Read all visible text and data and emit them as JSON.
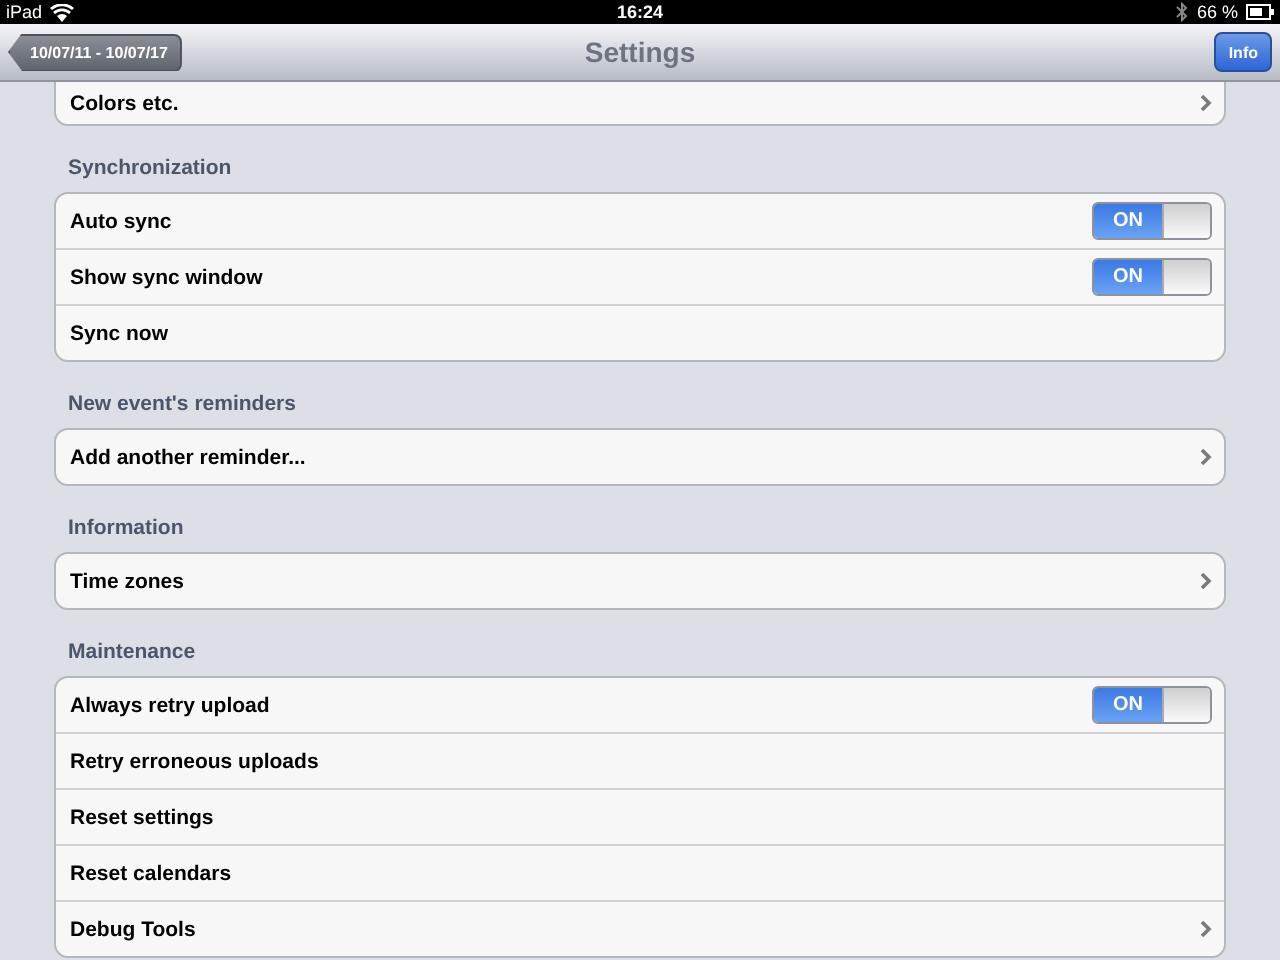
{
  "status_bar": {
    "device": "iPad",
    "time": "16:24",
    "battery": "66 %"
  },
  "nav_bar": {
    "back_button": "10/07/11 - 10/07/17",
    "title": "Settings",
    "info_button": "Info"
  },
  "sections": [
    {
      "rows": [
        {
          "kind": "disclosure",
          "label": "Colors etc."
        }
      ]
    },
    {
      "header": "Synchronization",
      "rows": [
        {
          "kind": "toggle",
          "label": "Auto sync",
          "on": true,
          "switch_text": "ON"
        },
        {
          "kind": "toggle",
          "label": "Show sync window",
          "on": true,
          "switch_text": "ON"
        },
        {
          "kind": "plain",
          "label": "Sync now"
        }
      ]
    },
    {
      "header": "New event's reminders",
      "rows": [
        {
          "kind": "disclosure",
          "label": "Add another reminder..."
        }
      ]
    },
    {
      "header": "Information",
      "rows": [
        {
          "kind": "disclosure",
          "label": "Time zones"
        }
      ]
    },
    {
      "header": "Maintenance",
      "rows": [
        {
          "kind": "toggle",
          "label": "Always retry upload",
          "on": true,
          "switch_text": "ON"
        },
        {
          "kind": "plain",
          "label": "Retry erroneous uploads"
        },
        {
          "kind": "plain",
          "label": "Reset settings"
        },
        {
          "kind": "plain",
          "label": "Reset calendars"
        },
        {
          "kind": "disclosure",
          "label": "Debug Tools"
        }
      ]
    }
  ]
}
